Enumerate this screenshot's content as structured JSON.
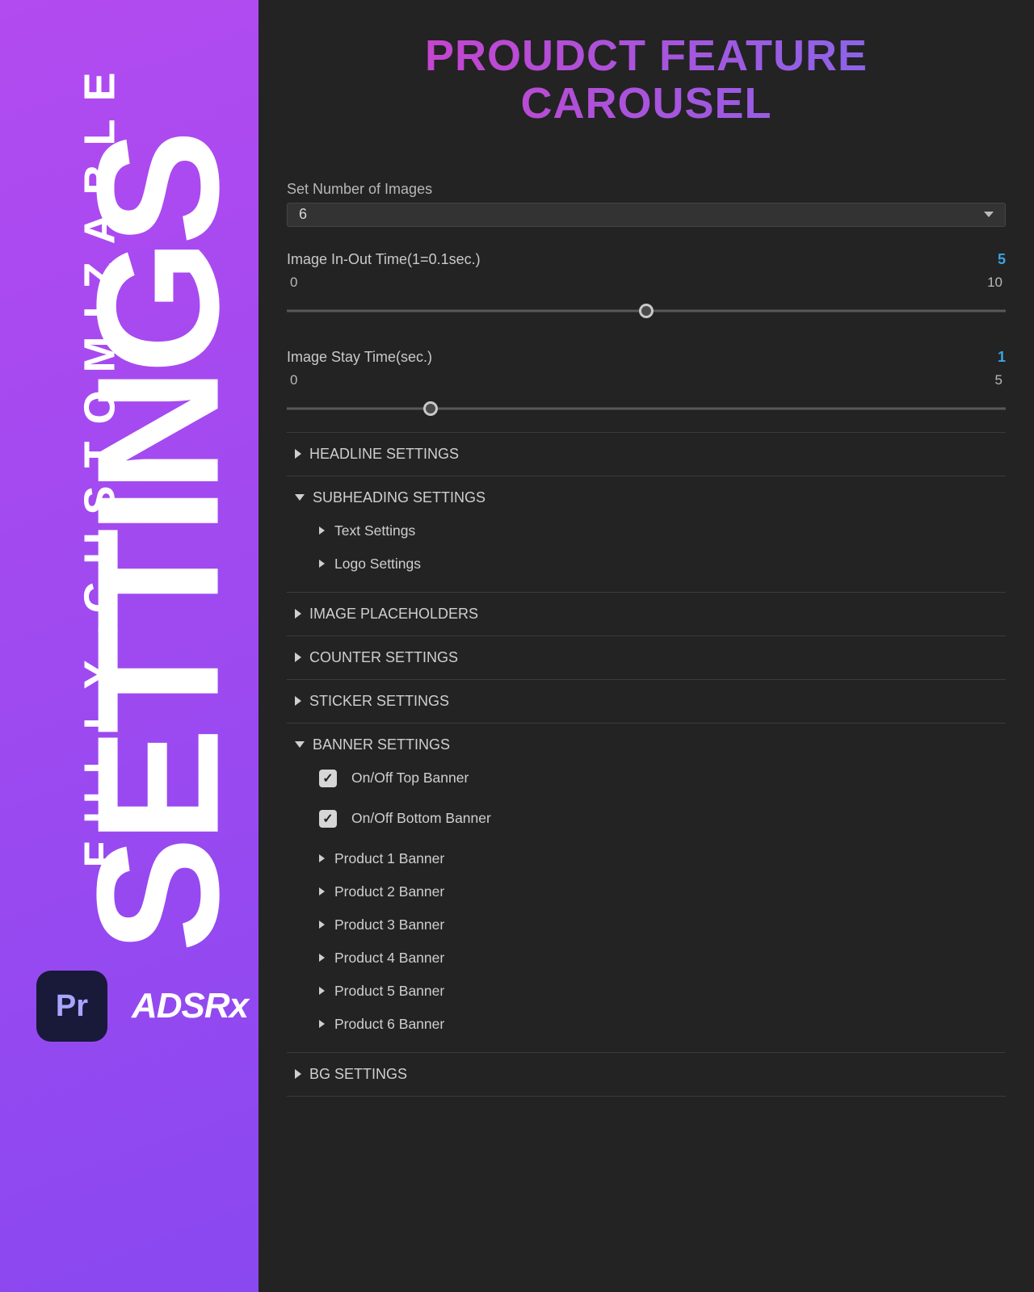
{
  "sidebar": {
    "big_text": "SETTINGS",
    "sub_text": "FULLY CUSTOMIZABLE",
    "pr_badge": "Pr",
    "brand": "ADSRx"
  },
  "header": {
    "title_line1": "PROUDCT FEATURE",
    "title_line2": "CAROUSEL"
  },
  "controls": {
    "num_images_label": "Set Number of Images",
    "num_images_value": "6",
    "inout": {
      "label": "Image In-Out Time(1=0.1sec.)",
      "value": "5",
      "min": "0",
      "max": "10",
      "thumb_pct": 50
    },
    "stay": {
      "label": "Image Stay Time(sec.)",
      "value": "1",
      "min": "0",
      "max": "5",
      "thumb_pct": 20
    }
  },
  "sections": {
    "headline": "HEADLINE SETTINGS",
    "subheading": {
      "label": "SUBHEADING SETTINGS",
      "text_settings": "Text Settings",
      "logo_settings": "Logo Settings"
    },
    "placeholders": "IMAGE PLACEHOLDERS",
    "counter": "COUNTER SETTINGS",
    "sticker": "STICKER SETTINGS",
    "banner": {
      "label": "BANNER SETTINGS",
      "top_toggle": "On/Off Top Banner",
      "bottom_toggle": "On/Off Bottom Banner",
      "products": [
        "Product 1 Banner",
        "Product 2 Banner",
        "Product 3 Banner",
        "Product 4 Banner",
        "Product 5 Banner",
        "Product 6 Banner"
      ]
    },
    "bg": "BG SETTINGS"
  }
}
